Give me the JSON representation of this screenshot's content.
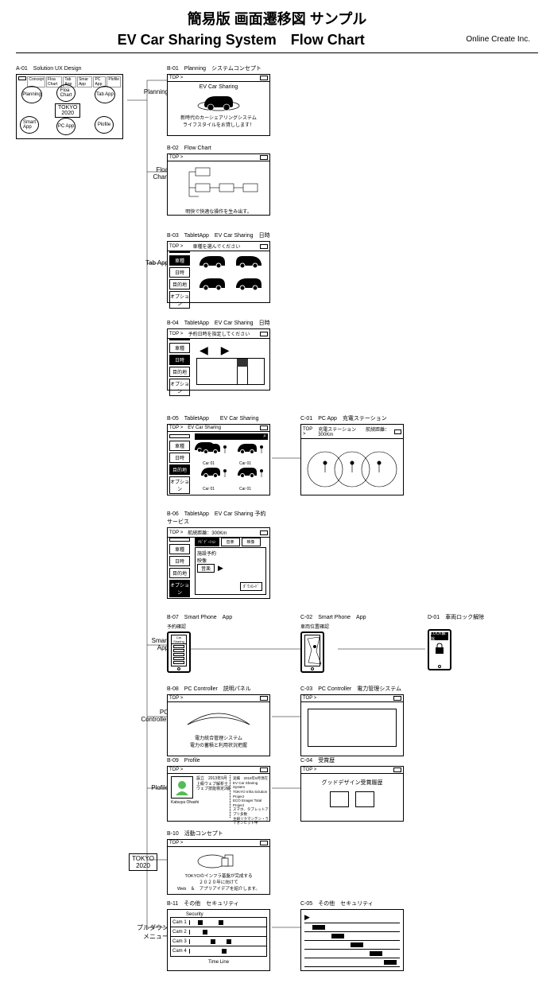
{
  "header": {
    "title_jp": "簡易版 画面遷移図 サンプル",
    "title_en": "EV Car Sharing System　Flow Chart",
    "company": "Online Create Inc."
  },
  "labels": {
    "planning": "Planning",
    "floa_chart": "Floa\nChart",
    "tab_app": "Tab App",
    "smart_app": "Smart\nApp",
    "pc_controller": "PC\nController",
    "profile": "Plofile",
    "tokyo2020": "TOKYO\n2020",
    "pulldown": "プルダウン\nメニュー"
  },
  "top_label": "TOP >",
  "a01": {
    "id": "A-01",
    "title": "Solution UX Design",
    "tabs": [
      "Concept",
      "Floa Chart",
      "Tab App",
      "Smar App",
      "PC App",
      "Plofile"
    ],
    "circles": [
      "Planning",
      "Floa\nChart",
      "Tab App",
      "Smart\nApp",
      "PC App",
      "Plofile"
    ],
    "center": "TOKYO\n2020"
  },
  "b01": {
    "id": "B-01",
    "title": "Planning　システムコンセプト",
    "heading": "EV Car Sharing",
    "line1": "新時代のカーシェアリングシステム",
    "line2": "ライフスタイルをお貸しします！"
  },
  "b02": {
    "id": "B-02",
    "title": "Flow Chart",
    "caption": "明快で快適な操作を生み出す。"
  },
  "b03": {
    "id": "B-03",
    "title": "TabletApp　EV Car Sharing　日時",
    "prompt": "車種を選んでください",
    "menu": [
      "車種",
      "日時",
      "目的地",
      "オプション"
    ],
    "sel": 0
  },
  "b04": {
    "id": "B-04",
    "title": "TabletApp　EV Car Sharing　日時",
    "prompt": "予約日時を指定してください",
    "menu": [
      "車種",
      "日時",
      "目的地",
      "オプション"
    ],
    "sel": 1
  },
  "b05": {
    "id": "B-05",
    "title": "TabletApp　　EV Car Sharing",
    "heading": "EV Car Sharing",
    "menu": [
      "車種",
      "日時",
      "目的地",
      "オプション"
    ],
    "sel": 2,
    "car_label": "Car 01"
  },
  "b06": {
    "id": "B-06",
    "title": "TabletApp　EV Car Sharing 予約サービス",
    "range": "航続距離：300Km",
    "tabs": [
      "ﾅﾋﾞｹﾞｰｼｮﾝ",
      "音楽",
      "映像"
    ],
    "menu": [
      "車種",
      "日時",
      "目的地",
      "オプション"
    ],
    "sel": 3,
    "items": [
      "施設予約",
      "映像",
      "音楽"
    ],
    "download": "ﾀﾞｳﾝﾛｰﾄﾞ"
  },
  "b07": {
    "id": "B-07",
    "title": "Smart Phone　App",
    "sub": "予約確認"
  },
  "b08": {
    "id": "B-08",
    "title": "PC Controller　説明パネル",
    "line1": "電力統合管理システム",
    "line2": "電力の蓄積と利用状況把握"
  },
  "b09": {
    "id": "B-09",
    "title": "Profile",
    "name": "Katsuya Ohashi",
    "left": [
      "設立　2013年9月",
      "上級ウェブ解析士",
      "ウェブ技能検定2級"
    ],
    "right_h": "実績　2019年9月現在",
    "right": [
      "EV Car Sharing System",
      "TOKYO Infra Sclution Project",
      "ECO Enager Total Project",
      "スマホ、タブレットアプリ多数",
      "主婦リクマンテン・ライオンヒット中"
    ]
  },
  "b10": {
    "id": "B-10",
    "title": "活動コンセプト",
    "line1": "TOKYOのインフラ基盤が完成する",
    "line2": "２０２０年に向けて",
    "line3": "Web　＆　アプリアイデアを紹介します。"
  },
  "b11": {
    "id": "B-11",
    "title": "その他　セキュリティ",
    "heading": "Security",
    "rows": [
      "Cam 1",
      "Cam 2",
      "Cam 3",
      "Cam 4"
    ],
    "footer": "Time Line"
  },
  "c01": {
    "id": "C-01",
    "title": "PC App　充電ステーション",
    "header": "充電ステーション　　航続距離：300Km"
  },
  "c02": {
    "id": "C-02",
    "title": "Smart Phone　App",
    "sub": "車両位置確認"
  },
  "c03": {
    "id": "C-03",
    "title": "PC Controller　電力管理システム"
  },
  "c04": {
    "id": "C-04",
    "title": "受賞歴",
    "text": "グッドデザイン受賞履歴"
  },
  "c05": {
    "id": "C-05",
    "title": "その他　セキュリティ"
  },
  "d01": {
    "id": "D-01",
    "title": "車両ロック解除",
    "btn": "LOCK解除"
  }
}
